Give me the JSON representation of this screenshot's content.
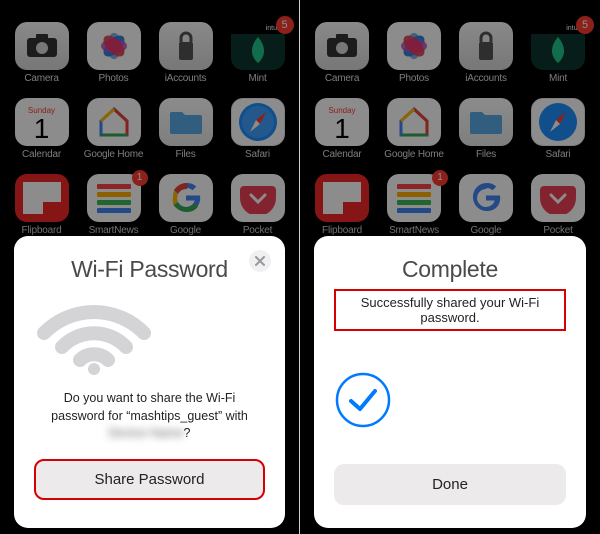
{
  "home": {
    "apps": [
      {
        "label": "Camera",
        "name": "camera-icon"
      },
      {
        "label": "Photos",
        "name": "photos-icon"
      },
      {
        "label": "iAccounts",
        "name": "iaccounts-icon"
      },
      {
        "label": "Mint",
        "name": "mint-icon",
        "badge": "5",
        "banner": "intuit"
      },
      {
        "label": "Calendar",
        "name": "calendar-icon",
        "cal_day": "Sunday",
        "cal_num": "1"
      },
      {
        "label": "Google Home",
        "name": "google-home-icon"
      },
      {
        "label": "Files",
        "name": "files-icon"
      },
      {
        "label": "Safari",
        "name": "safari-icon"
      },
      {
        "label": "Flipboard",
        "name": "flipboard-icon"
      },
      {
        "label": "SmartNews",
        "name": "smartnews-icon",
        "badge": "1"
      },
      {
        "label": "Google",
        "name": "google-icon"
      },
      {
        "label": "Pocket",
        "name": "pocket-icon"
      }
    ]
  },
  "left_sheet": {
    "title": "Wi-Fi Password",
    "prompt_prefix": "Do you want to share the Wi-Fi password for “",
    "network_name": "mashtips_guest",
    "prompt_suffix": "” with ",
    "recipient_redacted": "Device Name",
    "prompt_end": "?",
    "button": "Share Password"
  },
  "right_sheet": {
    "title": "Complete",
    "message": "Successfully shared your Wi-Fi password.",
    "button": "Done"
  },
  "colors": {
    "accent_blue": "#007aff",
    "highlight_red": "#d60000"
  }
}
